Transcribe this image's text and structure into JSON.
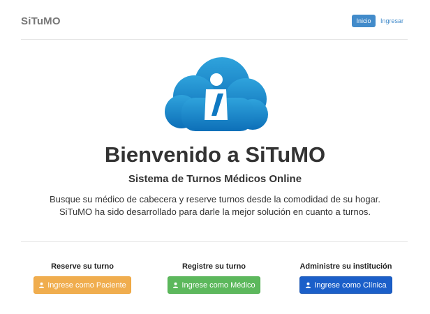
{
  "navbar": {
    "brand": "SiTuMO",
    "links": [
      {
        "label": "Inicio",
        "active": true
      },
      {
        "label": "Ingresar",
        "active": false
      }
    ]
  },
  "hero": {
    "logo_icon": "cloud-info-icon",
    "title": "Bienvenido a SiTuMO",
    "subtitle": "Sistema de Turnos Médicos Online",
    "description_line1": "Busque su médico de cabecera y reserve turnos desde la comodidad de su hogar.",
    "description_line2": "SiTuMO ha sido desarrollado para darle la mejor solución en cuanto a turnos."
  },
  "columns": [
    {
      "heading": "Reserve su turno",
      "button_label": "Ingrese como Paciente",
      "color": "#f0ad4e",
      "icon": "user-icon"
    },
    {
      "heading": "Registre su turno",
      "button_label": "Ingrese como Médico",
      "color": "#5cb85c",
      "icon": "user-icon"
    },
    {
      "heading": "Administre su institución",
      "button_label": "Ingrese como Clínica",
      "color": "#1b5fc9",
      "icon": "user-icon"
    }
  ]
}
